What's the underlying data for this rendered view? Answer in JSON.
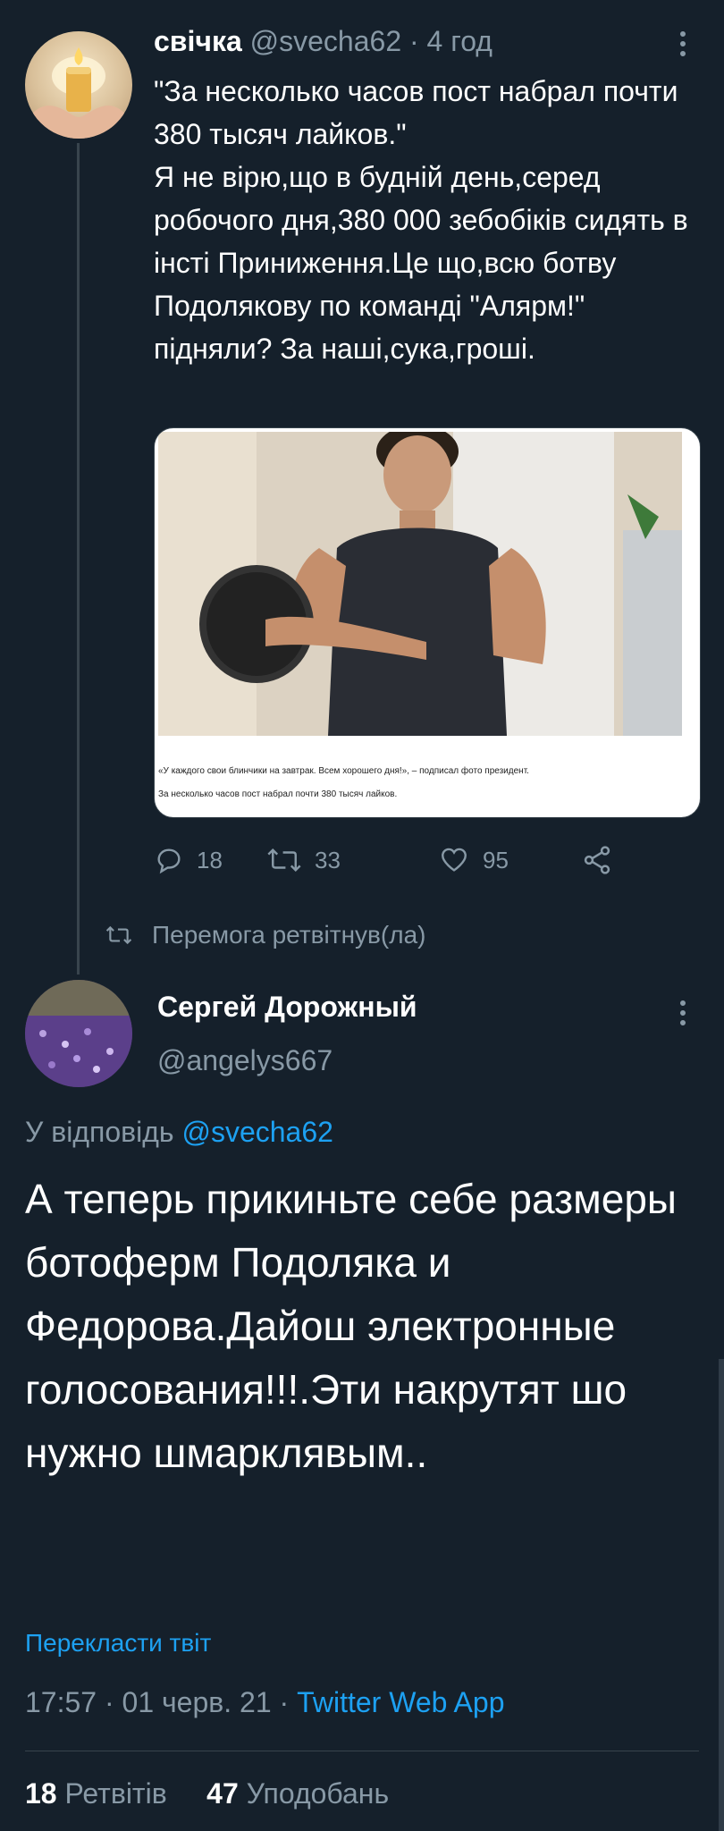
{
  "tweet1": {
    "name": "свічка",
    "handle": "@svecha62",
    "time": "4 год",
    "text_lines": [
      "\"За несколько часов пост набрал почти 380 тысяч лайков.\"",
      "Я не вірю,що в будній день,серед робочого дня,380 000 зебобіків сидять в інсті Приниження.Це що,всю ботву Подолякову по команді \"Алярм!\" підняли? За наші,сука,гроші."
    ],
    "media": {
      "caption_1": "«У каждого свои блинчики на завтрак. Всем хорошего дня!», – подписал фото президент.",
      "caption_2": "За несколько часов пост набрал почти 380 тысяч лайков."
    },
    "actions": {
      "replies": "18",
      "retweets": "33",
      "likes": "95"
    }
  },
  "retweet_note": "Перемога ретвітнув(ла)",
  "tweet2": {
    "name": "Сергей Дорожный",
    "handle": "@angelys667",
    "reply_prefix": "У відповідь",
    "reply_handle": "@svecha62",
    "text": "А теперь прикиньте себе размеры ботоферм Подоляка и Федорова.Дайош электронные голосования!!!.Эти накрутят шо нужно шмарклявым..",
    "translate": "Перекласти твіт",
    "time": "17:57",
    "date": "01 черв. 21",
    "source": "Twitter Web App",
    "retweets_count": "18",
    "retweets_label": "Ретвітів",
    "likes_count": "47",
    "likes_label": "Уподобань"
  },
  "colors": {
    "background": "#15202b",
    "muted": "#8899a6",
    "link": "#1da1f2",
    "divider": "#38444d"
  }
}
